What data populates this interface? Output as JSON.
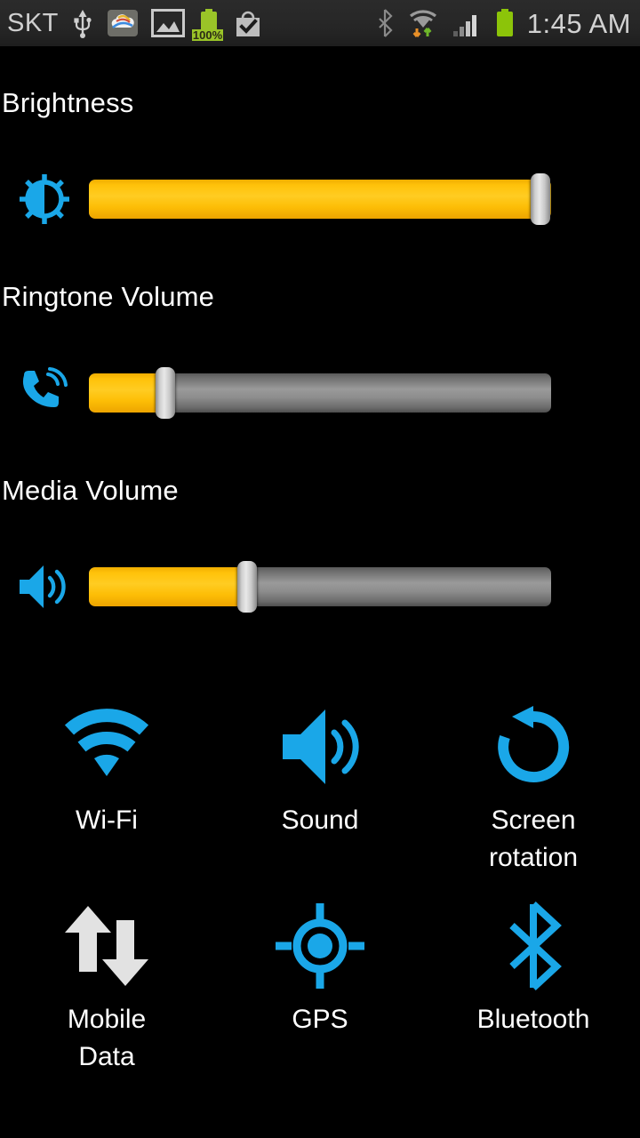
{
  "statusbar": {
    "carrier": "SKT",
    "clock": "1:45 AM",
    "battery_percent": "100%",
    "left_icons": [
      "usb-icon",
      "cloud-sync-icon",
      "screenshot-image-icon",
      "battery-charging-icon",
      "checkmark-bag-icon"
    ],
    "right_icons": [
      "bluetooth-icon",
      "wifi-data-activity-icon",
      "cellular-signal-icon",
      "battery-full-icon"
    ],
    "bg_color": "#262626"
  },
  "sections": [
    {
      "title": "Brightness",
      "icon": "brightness-sun-icon",
      "value_percent": 100,
      "icon_color": "#1aa7e8",
      "fill_color": "#ffc20a"
    },
    {
      "title": "Ringtone Volume",
      "icon": "phone-ringing-icon",
      "value_percent": 16,
      "icon_color": "#1aa7e8",
      "fill_color": "#ffc20a"
    },
    {
      "title": "Media Volume",
      "icon": "speaker-volume-icon",
      "value_percent": 34,
      "icon_color": "#1aa7e8",
      "fill_color": "#ffc20a"
    }
  ],
  "toggles": [
    {
      "label": "Wi-Fi",
      "icon": "wifi-icon",
      "state": "on",
      "color": "#1aa7e8"
    },
    {
      "label": "Sound",
      "icon": "speaker-icon",
      "state": "on",
      "color": "#1aa7e8"
    },
    {
      "label": "Screen\nrotation",
      "icon": "rotate-screen-icon",
      "state": "on",
      "color": "#1aa7e8"
    },
    {
      "label": "Mobile\nData",
      "icon": "mobile-data-arrows-icon",
      "state": "off",
      "color": "#e8e8e8"
    },
    {
      "label": "GPS",
      "icon": "gps-crosshair-icon",
      "state": "on",
      "color": "#1aa7e8"
    },
    {
      "label": "Bluetooth",
      "icon": "bluetooth-icon",
      "state": "on",
      "color": "#1aa7e8"
    }
  ],
  "theme": {
    "background": "#000000",
    "accent": "#1aa7e8",
    "slider_fill": "#ffc20a",
    "slider_track": "#8d8d8d",
    "text": "#ffffff"
  }
}
